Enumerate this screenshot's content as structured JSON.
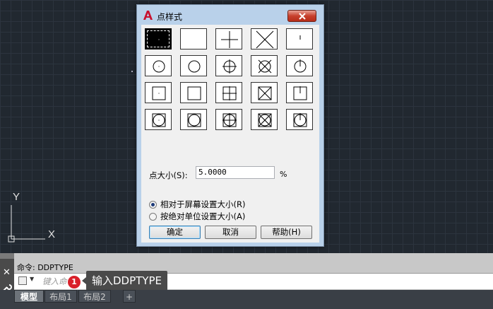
{
  "dialog": {
    "title": "点样式",
    "size_label": "点大小(S):",
    "size_value": "5.0000",
    "size_unit": "%",
    "radio_relative": "相对于屏幕设置大小(R)",
    "radio_absolute": "按绝对单位设置大小(A)",
    "ok_label": "确定",
    "cancel_label": "取消",
    "help_label": "帮助(H)",
    "point_styles": [
      "dot",
      "none",
      "plus",
      "cross",
      "tick",
      "circle-dot",
      "circle",
      "circle-plus",
      "circle-cross",
      "circle-tick",
      "square-dot",
      "square",
      "square-plus",
      "square-cross",
      "square-tick",
      "circlesquare-dot",
      "circlesquare",
      "circlesquare-plus",
      "circlesquare-cross",
      "circlesquare-tick"
    ],
    "selected_style_index": 0
  },
  "ucs": {
    "y_label": "Y",
    "x_label": "X"
  },
  "command": {
    "history": "命令: DDPTYPE",
    "placeholder": "键入命令",
    "step_number": "1",
    "tooltip": "输入DDPTYPE"
  },
  "tabs": [
    {
      "label": "模型",
      "active": true
    },
    {
      "label": "布局1",
      "active": false
    },
    {
      "label": "布局2",
      "active": false
    },
    {
      "label": "+",
      "active": false
    }
  ],
  "colors": {
    "accent_red": "#d9202a",
    "close_button": "#c7402d",
    "canvas": "#212830"
  }
}
